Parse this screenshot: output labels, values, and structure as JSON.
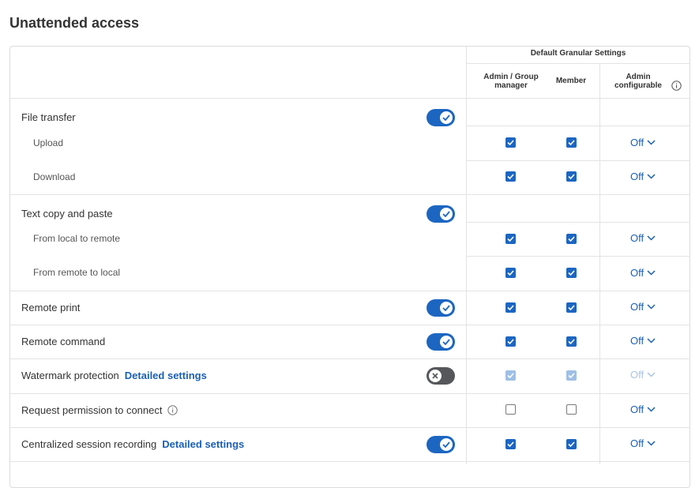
{
  "page": {
    "title": "Unattended access"
  },
  "header": {
    "group_label": "Default Granular Settings",
    "col_admin": "Admin / Group manager",
    "col_member": "Member",
    "col_configurable": "Admin configurable"
  },
  "rows": {
    "file_transfer": {
      "label": "File transfer",
      "toggle": "on"
    },
    "upload": {
      "label": "Upload",
      "admin": true,
      "member": true,
      "config": "Off"
    },
    "download": {
      "label": "Download",
      "admin": true,
      "member": true,
      "config": "Off"
    },
    "text_copy": {
      "label": "Text copy and paste",
      "toggle": "on"
    },
    "local_to_remote": {
      "label": "From local to remote",
      "admin": true,
      "member": true,
      "config": "Off"
    },
    "remote_to_local": {
      "label": "From remote to local",
      "admin": true,
      "member": true,
      "config": "Off"
    },
    "remote_print": {
      "label": "Remote print",
      "toggle": "on",
      "admin": true,
      "member": true,
      "config": "Off"
    },
    "remote_command": {
      "label": "Remote command",
      "toggle": "on",
      "admin": true,
      "member": true,
      "config": "Off"
    },
    "watermark": {
      "label": "Watermark protection",
      "link": "Detailed settings",
      "toggle": "off",
      "admin": true,
      "member": true,
      "config": "Off"
    },
    "request_permission": {
      "label": "Request permission to connect",
      "admin": false,
      "member": false,
      "config": "Off"
    },
    "session_recording": {
      "label": "Centralized session recording",
      "link": "Detailed settings",
      "toggle": "on",
      "admin": true,
      "member": true,
      "config": "Off"
    }
  },
  "colors": {
    "accent": "#1c66c2",
    "link": "#1a5fb4",
    "toggle_off": "#55575b"
  },
  "icons": {
    "check": "check-icon",
    "chevron": "chevron-down-icon",
    "info": "info-icon",
    "close": "close-icon"
  }
}
